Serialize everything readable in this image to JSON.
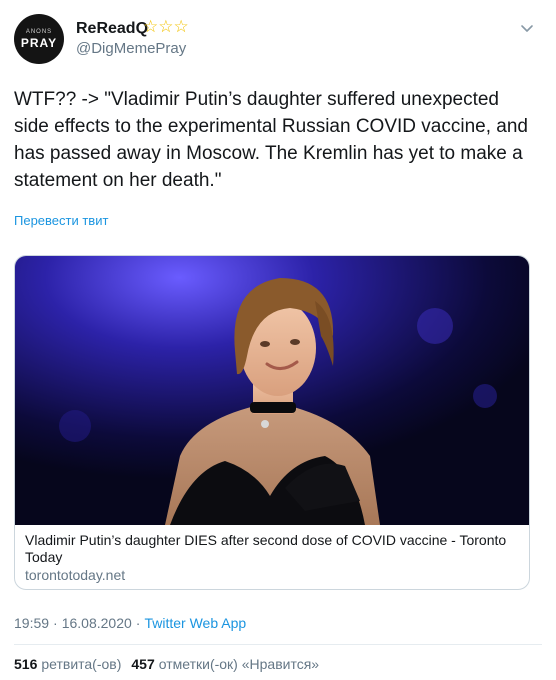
{
  "tweet": {
    "avatar": {
      "top_text": "ANONS",
      "bottom_text": "PRAY"
    },
    "display_name": "ReReadQ",
    "badges": "☆☆☆",
    "handle": "@DigMemePray",
    "text": "WTF?? -> \"Vladimir Putin’s daughter suffered unexpected side effects to the experimental Russian COVID vaccine, and has passed away in Moscow. The Kremlin has yet to make a statement on her death.\"",
    "translate_link": "Перевести твит",
    "card": {
      "title": "Vladimir Putin’s daughter DIES after second dose of COVID vaccine - Toronto Today",
      "domain": "torontotoday.net"
    },
    "time": "19:59",
    "date": "16.08.2020",
    "source": "Twitter Web App",
    "retweets_count": "516",
    "retweets_label": "ретвита(-ов)",
    "likes_count": "457",
    "likes_label": "отметки(-ок) «Нравится»"
  },
  "colors": {
    "link": "#1b95e0",
    "secondary_text": "#657786",
    "stars": "#f2c200",
    "border": "#ccd6dd"
  }
}
